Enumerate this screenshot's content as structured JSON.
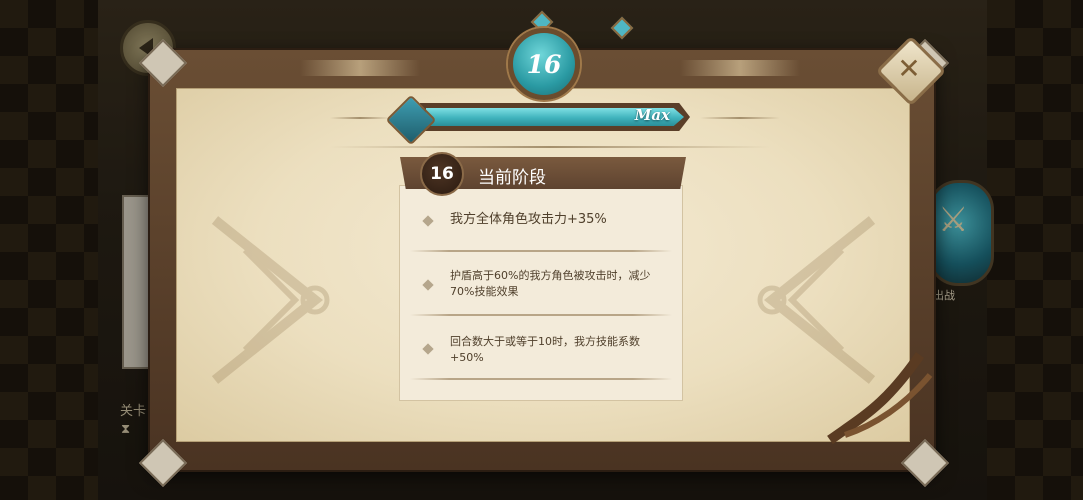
{
  "level_badge": {
    "value": "16"
  },
  "progress": {
    "label": "Max",
    "fraction": 1.0
  },
  "stage": {
    "number": "16",
    "title": "当前阶段"
  },
  "effects": [
    {
      "text": "我方全体角色攻击力+35%"
    },
    {
      "text": "护盾高于60%的我方角色被攻击时，减少70%技能效果"
    },
    {
      "text": "回合数大于或等于10时，我方技能系数+50%"
    }
  ],
  "background": {
    "stage_label": "关卡",
    "timer_icon": "hourglass-icon",
    "battle_label": "出战"
  },
  "colors": {
    "accent_teal": "#3fb3bd",
    "frame_brown": "#5e4330",
    "parchment": "#f4ead3"
  }
}
